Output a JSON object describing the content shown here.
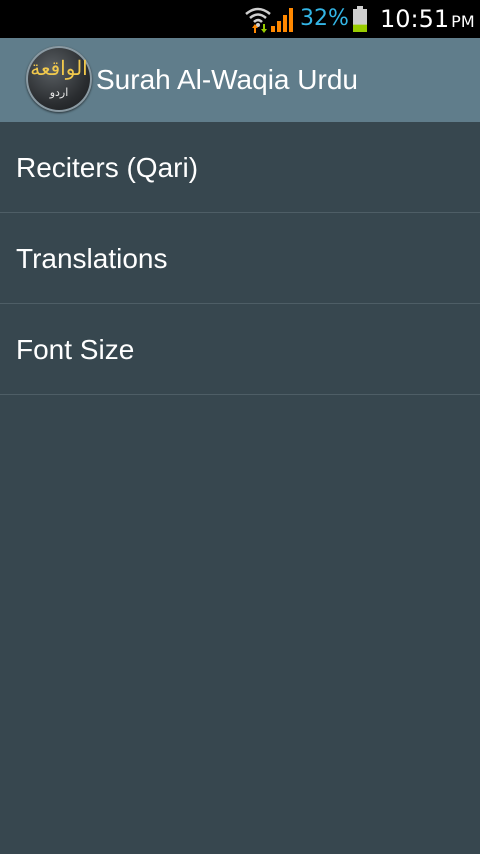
{
  "status_bar": {
    "battery_percent": "32%",
    "battery_level": 0.32,
    "time": "10:51",
    "ampm": "PM",
    "colors": {
      "battery_percent_text": "#33b5e5",
      "signal": "#ff8800",
      "battery_fill": "#99cc00"
    },
    "icons": [
      "wifi-icon",
      "signal-icon",
      "battery-icon"
    ]
  },
  "action_bar": {
    "title": "Surah Al-Waqia Urdu",
    "icon": {
      "arabic_text": "الواقعة",
      "arabic_subtext": "اردو"
    },
    "background": "#607d8b"
  },
  "menu": {
    "items": [
      {
        "label": "Reciters (Qari)"
      },
      {
        "label": "Translations"
      },
      {
        "label": "Font Size"
      }
    ]
  },
  "theme": {
    "background": "#37474f",
    "divider": "#4e5e66"
  }
}
